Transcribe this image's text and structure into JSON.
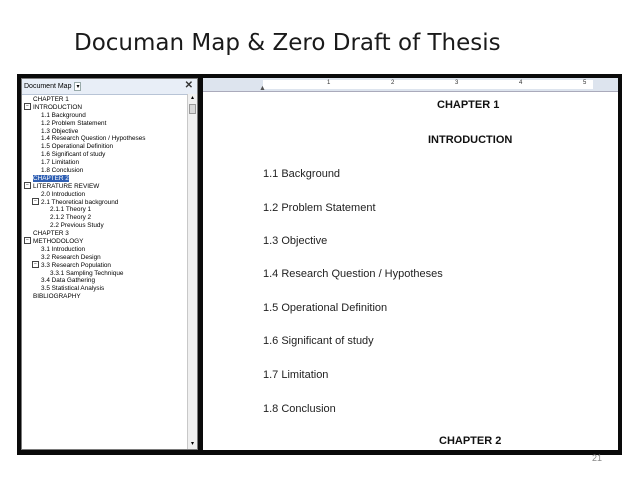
{
  "slide": {
    "title": "Documan Map & Zero Draft of Thesis",
    "page_number": "21"
  },
  "doc_map": {
    "title": "Document Map",
    "dropdown": "▾",
    "close": "✕",
    "items": [
      {
        "label": "CHAPTER 1",
        "indent": 0,
        "box": ""
      },
      {
        "label": "INTRODUCTION",
        "indent": 0,
        "box": "−"
      },
      {
        "label": "1.1 Background",
        "indent": 2,
        "box": ""
      },
      {
        "label": "1.2 Problem Statement",
        "indent": 2,
        "box": ""
      },
      {
        "label": "1.3 Objective",
        "indent": 2,
        "box": ""
      },
      {
        "label": "1.4 Research Question / Hypotheses",
        "indent": 2,
        "box": ""
      },
      {
        "label": "1.5 Operational Definition",
        "indent": 2,
        "box": ""
      },
      {
        "label": "1.6 Significant of study",
        "indent": 2,
        "box": ""
      },
      {
        "label": "1.7 Limitation",
        "indent": 2,
        "box": ""
      },
      {
        "label": "1.8 Conclusion",
        "indent": 2,
        "box": ""
      },
      {
        "label": "CHAPTER 2",
        "indent": 0,
        "box": "",
        "selected": true
      },
      {
        "label": "LITERATURE REVIEW",
        "indent": 0,
        "box": "−"
      },
      {
        "label": "2.0 Introduction",
        "indent": 2,
        "box": ""
      },
      {
        "label": "2.1 Theoretical background",
        "indent": 1,
        "box": "−"
      },
      {
        "label": "2.1.1 Theory 1",
        "indent": 3,
        "box": ""
      },
      {
        "label": "2.1.2 Theory 2",
        "indent": 3,
        "box": ""
      },
      {
        "label": "2.2 Previous Study",
        "indent": 3,
        "box": ""
      },
      {
        "label": "CHAPTER 3",
        "indent": 0,
        "box": ""
      },
      {
        "label": "METHODOLOGY",
        "indent": 0,
        "box": "−"
      },
      {
        "label": "3.1 Introduction",
        "indent": 2,
        "box": ""
      },
      {
        "label": "3.2 Research Design",
        "indent": 2,
        "box": ""
      },
      {
        "label": "3.3 Research Population",
        "indent": 1,
        "box": "−"
      },
      {
        "label": "3.3.1 Sampling Technique",
        "indent": 3,
        "box": ""
      },
      {
        "label": "3.4 Data Gathering",
        "indent": 2,
        "box": ""
      },
      {
        "label": "3.5 Statistical Analysis",
        "indent": 2,
        "box": ""
      },
      {
        "label": "BIBLIOGRAPHY",
        "indent": 0,
        "box": ""
      }
    ]
  },
  "ruler": {
    "labels": [
      "1",
      "2",
      "3",
      "4",
      "5"
    ]
  },
  "document": {
    "chapter1": "CHAPTER 1",
    "intro": "INTRODUCTION",
    "sections": [
      "1.1 Background",
      "1.2 Problem Statement",
      "1.3 Objective",
      "1.4 Research Question / Hypotheses",
      "1.5 Operational Definition",
      "1.6 Significant of study",
      "1.7 Limitation",
      "1.8 Conclusion"
    ],
    "chapter2": "CHAPTER 2"
  }
}
